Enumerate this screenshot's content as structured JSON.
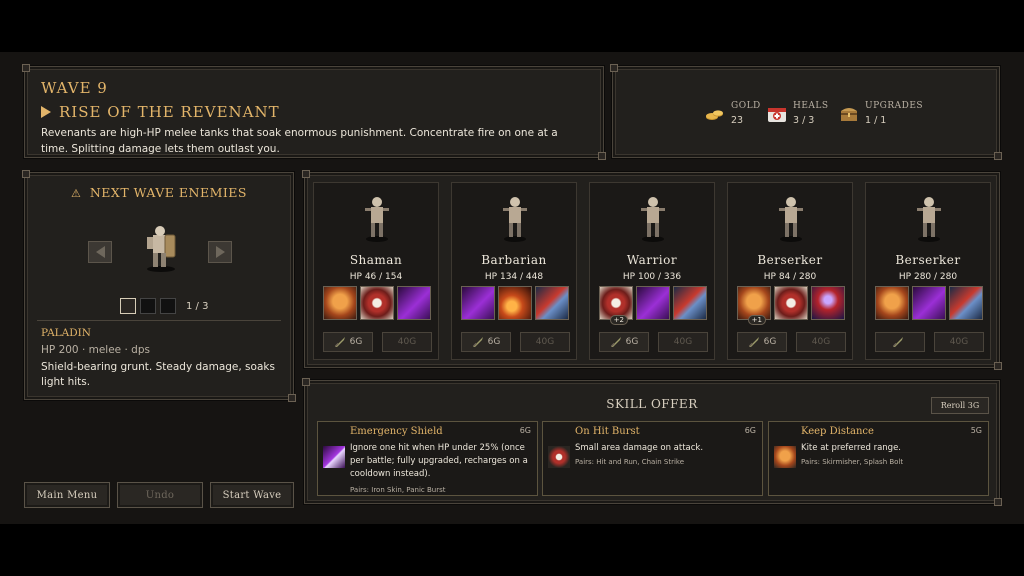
{
  "header": {
    "wave": "WAVE 9",
    "title": "RISE OF THE REVENANT",
    "description": "Revenants are high-HP melee tanks that soak enormous punishment. Concentrate fire on one at a time. Splitting damage lets them outlast you."
  },
  "resources": [
    {
      "label": "GOLD",
      "value": "23",
      "icon": "gold-coins-icon"
    },
    {
      "label": "HEALS",
      "value": "3 / 3",
      "icon": "medkit-icon"
    },
    {
      "label": "UPGRADES",
      "value": "1 / 1",
      "icon": "treasure-chest-icon"
    }
  ],
  "next_wave": {
    "title": "NEXT WAVE ENEMIES",
    "warning_icon": "⚠",
    "page": "1 / 3",
    "enemy_name": "PALADIN",
    "enemy_stats": "HP 200 · melee · dps",
    "enemy_desc": "Shield-bearing grunt. Steady damage, soaks light hits."
  },
  "buttons": {
    "main_menu": "Main Menu",
    "undo": "Undo",
    "start_wave": "Start  Wave"
  },
  "heroes": [
    {
      "name": "Shaman",
      "hp": "HP 46 / 154",
      "skills": [
        "orange",
        "burst",
        "purple"
      ],
      "badges": [
        "",
        "",
        ""
      ],
      "upgrade_cost": "6G",
      "buy_cost": "40G"
    },
    {
      "name": "Barbarian",
      "hp": "HP 134 / 448",
      "skills": [
        "purple",
        "fire",
        "blade"
      ],
      "badges": [
        "",
        "",
        ""
      ],
      "upgrade_cost": "6G",
      "buy_cost": "40G"
    },
    {
      "name": "Warrior",
      "hp": "HP 100 / 336",
      "skills": [
        "burst",
        "purple",
        "blade"
      ],
      "badges": [
        "+2",
        "",
        ""
      ],
      "upgrade_cost": "6G",
      "buy_cost": "40G"
    },
    {
      "name": "Berserker",
      "hp": "HP 84 / 280",
      "skills": [
        "orange",
        "burst",
        "mage"
      ],
      "badges": [
        "+1",
        "",
        ""
      ],
      "upgrade_cost": "6G",
      "buy_cost": "40G"
    },
    {
      "name": "Berserker",
      "hp": "HP 280 / 280",
      "skills": [
        "orange",
        "purple",
        "blade"
      ],
      "badges": [
        "",
        "",
        ""
      ],
      "upgrade_cost": "",
      "buy_cost": "40G"
    }
  ],
  "skill_offer": {
    "title": "SKILL OFFER",
    "reroll": "Reroll 3G",
    "cards": [
      {
        "title": "Emergency Shield",
        "cost": "6G",
        "desc": "Ignore one hit when HP under 25% (once per battle; fully upgraded, recharges on a cooldown instead).",
        "pairs": "Pairs: Iron Skin, Panic Burst",
        "icon": "purple-slash-icon"
      },
      {
        "title": "On Hit Burst",
        "cost": "6G",
        "desc": "Small area damage on attack.",
        "pairs": "Pairs: Hit and Run, Chain Strike",
        "icon": "burst-icon"
      },
      {
        "title": "Keep Distance",
        "cost": "5G",
        "desc": "Kite at preferred range.",
        "pairs": "Pairs: Skirmisher, Splash Bolt",
        "icon": "orange-slash-icon"
      }
    ]
  }
}
